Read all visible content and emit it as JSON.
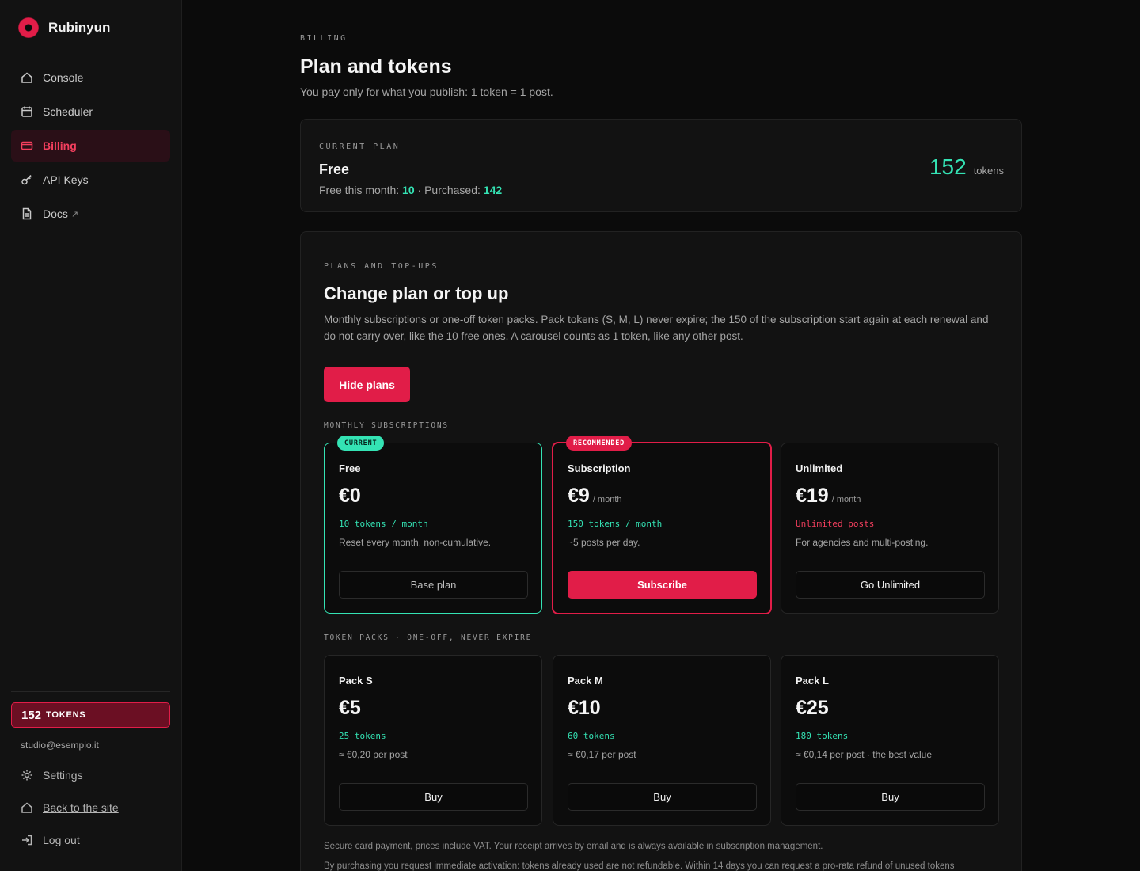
{
  "brand": {
    "name": "Rubinyun"
  },
  "nav": {
    "items": [
      {
        "label": "Console",
        "icon": "home-icon"
      },
      {
        "label": "Scheduler",
        "icon": "calendar-icon"
      },
      {
        "label": "Billing",
        "icon": "card-icon",
        "active": true
      },
      {
        "label": "API Keys",
        "icon": "key-icon"
      },
      {
        "label": "Docs",
        "icon": "doc-icon",
        "external": "↗"
      }
    ]
  },
  "sidebar_footer": {
    "token_count": "152",
    "token_label": "TOKENS",
    "email": "studio@esempio.it",
    "settings": "Settings",
    "back": "Back to the site",
    "logout": "Log out"
  },
  "header": {
    "eyebrow": "BILLING",
    "title": "Plan and tokens",
    "subtitle": "You pay only for what you publish: 1 token = 1 post."
  },
  "current_plan": {
    "eyebrow": "CURRENT PLAN",
    "name": "Free",
    "free_label": "Free this month:",
    "free_value": "10",
    "sep": "·",
    "purchased_label": "Purchased:",
    "purchased_value": "142",
    "balance": "152",
    "balance_unit": "tokens"
  },
  "plans": {
    "eyebrow": "PLANS AND TOP-UPS",
    "title": "Change plan or top up",
    "description": "Monthly subscriptions or one-off token packs. Pack tokens (S, M, L) never expire; the 150 of the subscription start again at each renewal and do not carry over, like the 10 free ones. A carousel counts as 1 token, like any other post.",
    "hide_button": "Hide plans",
    "subscriptions_label": "MONTHLY SUBSCRIPTIONS",
    "subscriptions": [
      {
        "tag": "CURRENT",
        "name": "Free",
        "price": "€0",
        "per": "",
        "tokens": "10 tokens / month",
        "note": "Reset every month, non-cumulative.",
        "button": "Base plan"
      },
      {
        "tag": "RECOMMENDED",
        "name": "Subscription",
        "price": "€9",
        "per": "/ month",
        "tokens": "150 tokens / month",
        "note": "~5 posts per day.",
        "button": "Subscribe"
      },
      {
        "tag": "",
        "name": "Unlimited",
        "price": "€19",
        "per": "/ month",
        "tokens": "Unlimited posts",
        "note": "For agencies and multi-posting.",
        "button": "Go Unlimited"
      }
    ],
    "packs_label": "TOKEN PACKS · ONE-OFF, NEVER EXPIRE",
    "packs": [
      {
        "name": "Pack S",
        "price": "€5",
        "tokens": "25 tokens",
        "note": "≈ €0,20 per post",
        "button": "Buy"
      },
      {
        "name": "Pack M",
        "price": "€10",
        "tokens": "60 tokens",
        "note": "≈ €0,17 per post",
        "button": "Buy"
      },
      {
        "name": "Pack L",
        "price": "€25",
        "tokens": "180 tokens",
        "note": "≈ €0,14 per post · the best value",
        "button": "Buy"
      }
    ],
    "footnote_1": "Secure card payment, prices include VAT. Your receipt arrives by email and is always available in subscription management.",
    "footnote_2": "By purchasing you request immediate activation: tokens already used are not refundable. Within 14 days you can request a pro-rata refund of unused tokens"
  },
  "colors": {
    "accent_red": "#e11d48",
    "accent_green": "#34e3b4",
    "background": "#0b0b0b"
  }
}
